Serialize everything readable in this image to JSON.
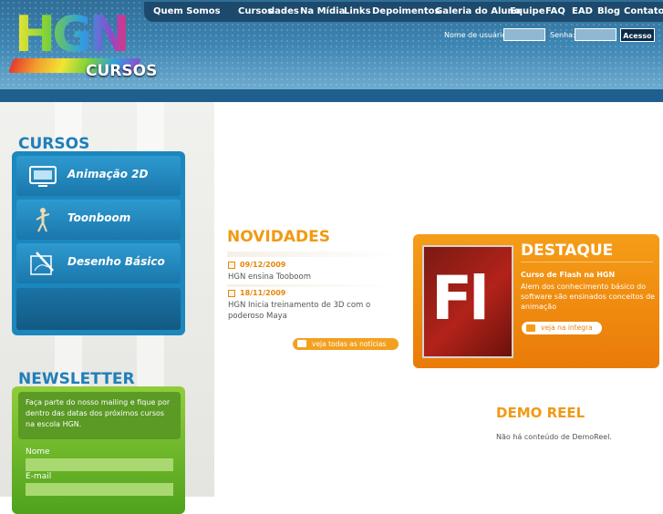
{
  "brand": {
    "logo_text": "HGN",
    "logo_sub": "CURSOS"
  },
  "nav": {
    "items": [
      "Quem Somos",
      "Cursos",
      "dades",
      "Na Mídia",
      "Links",
      "Depoimentos",
      "Galeria do Aluno",
      "Equipe",
      "FAQ",
      "EAD",
      "Blog",
      "Contato"
    ]
  },
  "login": {
    "user_label": "Nome de usuário:",
    "pass_label": "Senha:",
    "button": "Acesso"
  },
  "sidebar": {
    "cursos_title": "CURSOS",
    "courses": [
      {
        "label": "Animação 2D",
        "icon": "tv-icon"
      },
      {
        "label": "Toonboom",
        "icon": "mannequin-icon"
      },
      {
        "label": "Desenho Básico",
        "icon": "pencil-drawing-icon"
      }
    ],
    "newsletter_title": "NEWSLETTER",
    "newsletter_text": "Faça parte do nosso mailing e fique por dentro das datas dos próximos cursos na escola HGN.",
    "name_label": "Nome",
    "email_label": "E-mail"
  },
  "novidades": {
    "title": "NOVIDADES",
    "items": [
      {
        "date": "09/12/2009",
        "text": "HGN ensina Tooboom"
      },
      {
        "date": "18/11/2009",
        "text": "HGN Inicia treinamento de 3D com o poderoso Maya"
      }
    ],
    "all_link": "veja todas as notícias"
  },
  "destaque": {
    "title": "DESTAQUE",
    "image_text": "Fl",
    "subtitle": "Curso de Flash na HGN",
    "description": "Alem dos conhecimento básico do software são ensinados conceitos de animação",
    "button": "veja na integra"
  },
  "demo_reel": {
    "title": "DEMO REEL",
    "text": "Não há conteúdo de DemoReel."
  },
  "colors": {
    "blue": "#1f7fb9",
    "orange": "#f09a14",
    "green": "#6cba2b"
  }
}
